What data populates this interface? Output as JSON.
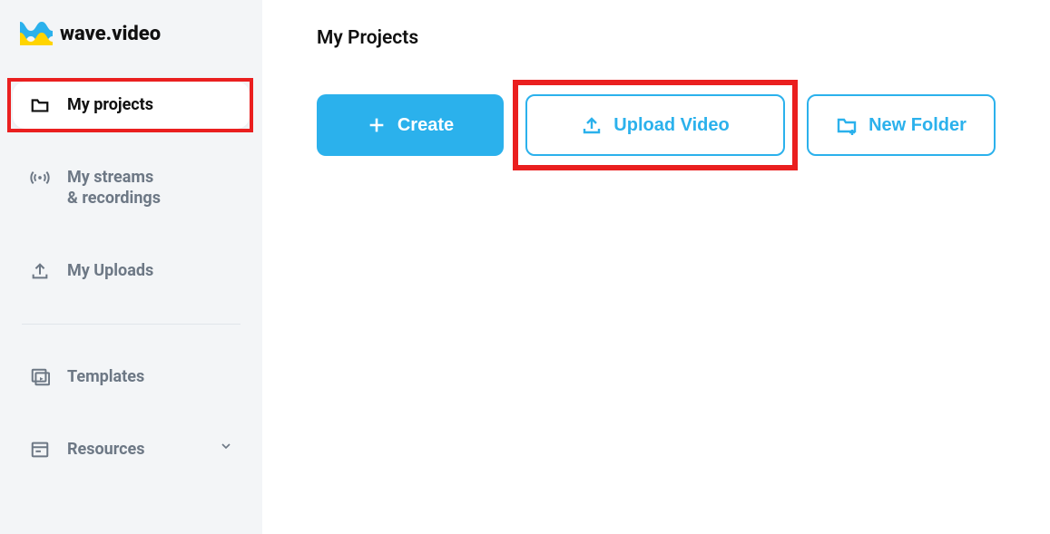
{
  "brand": {
    "name": "wave.video"
  },
  "sidebar": {
    "items": [
      {
        "label": "My projects",
        "sublabel": ""
      },
      {
        "label": "My streams",
        "sublabel": "& recordings"
      },
      {
        "label": "My Uploads",
        "sublabel": ""
      },
      {
        "label": "Templates",
        "sublabel": ""
      },
      {
        "label": "Resources",
        "sublabel": ""
      }
    ]
  },
  "main": {
    "title": "My Projects",
    "actions": {
      "create": "Create",
      "upload": "Upload Video",
      "newFolder": "New Folder"
    }
  },
  "colors": {
    "accent": "#2bb1ec",
    "highlight": "#ea1f1f"
  }
}
